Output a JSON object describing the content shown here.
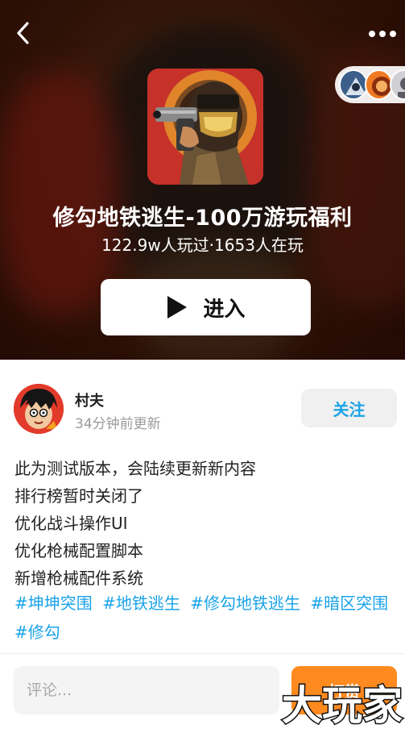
{
  "header": {
    "back_icon": "chevron-left-icon",
    "more_icon": "more-horizontal-icon"
  },
  "game": {
    "title": "修勾地铁逃生-100万游玩福利",
    "stats": "122.9w人玩过·1653人在玩",
    "enter_label": "进入",
    "play_icon": "play-icon"
  },
  "post": {
    "author_name": "村夫",
    "updated": "34分钟前更新",
    "follow_label": "关注",
    "lines": [
      "此为测试版本，会陆续更新新内容",
      "排行榜暂时关闭了",
      "优化战斗操作UI",
      "优化枪械配置脚本",
      "新增枪械配件系统"
    ],
    "tags": [
      "#坤坤突围",
      "#地铁逃生",
      "#修勾地铁逃生",
      "#暗区突围",
      "#修勾"
    ]
  },
  "footer": {
    "comment_placeholder": "评论...",
    "reward_label": "打赏",
    "watermark_text": "大玩家"
  },
  "colors": {
    "accent": "#1aa3e8",
    "reward": "#ff8a1f"
  }
}
